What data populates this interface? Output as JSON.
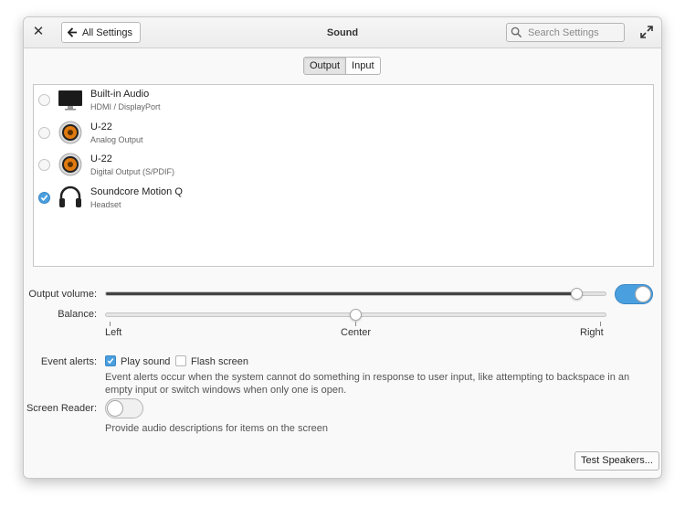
{
  "header": {
    "title": "Sound",
    "back_label": "All Settings",
    "search_placeholder": "Search Settings"
  },
  "tabs": [
    {
      "label": "Output",
      "active": true
    },
    {
      "label": "Input",
      "active": false
    }
  ],
  "devices": [
    {
      "name": "Built-in Audio",
      "description": "HDMI / DisplayPort",
      "icon": "monitor-icon",
      "selected": false
    },
    {
      "name": "U-22",
      "description": "Analog Output",
      "icon": "speaker-icon",
      "selected": false
    },
    {
      "name": "U-22",
      "description": "Digital Output (S/PDIF)",
      "icon": "speaker-icon",
      "selected": false
    },
    {
      "name": "Soundcore Motion Q",
      "description": "Headset",
      "icon": "headset-icon",
      "selected": true
    }
  ],
  "output_volume": {
    "label": "Output volume:",
    "value": 0.94,
    "enabled": true
  },
  "balance": {
    "label": "Balance:",
    "value": 0.5,
    "left_label": "Left",
    "center_label": "Center",
    "right_label": "Right"
  },
  "event_alerts": {
    "label": "Event alerts:",
    "play_sound_label": "Play sound",
    "play_sound": true,
    "flash_screen_label": "Flash screen",
    "flash_screen": false,
    "description_line1": "Event alerts occur when the system cannot do something in response to user input, like attempting to backspace in an",
    "description_line2": "empty input or switch windows when only one is open."
  },
  "screen_reader": {
    "label": "Screen Reader:",
    "enabled": false,
    "description": "Provide audio descriptions for items on the screen"
  },
  "test_speakers_label": "Test Speakers...",
  "colors": {
    "accent": "#4a9fdf",
    "speaker_orange": "#e07a10"
  }
}
